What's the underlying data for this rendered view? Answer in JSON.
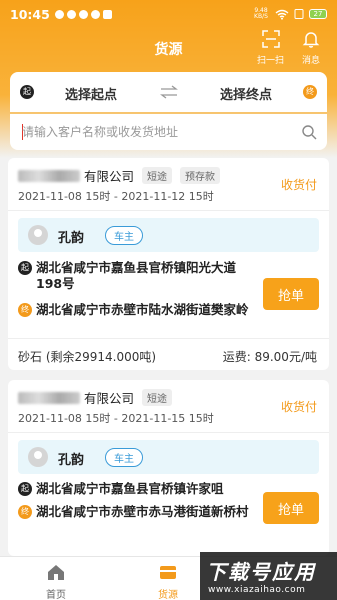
{
  "status_bar": {
    "time": "10:45",
    "network": "9.48 KB/S",
    "battery": "27"
  },
  "header": {
    "title": "货源",
    "scan_label": "扫一扫",
    "message_label": "消息"
  },
  "route": {
    "start_badge": "起",
    "start_label": "选择起点",
    "end_label": "选择终点",
    "end_badge": "终"
  },
  "search": {
    "placeholder": "请输入客户名称或收发货地址"
  },
  "cards": [
    {
      "company_suffix": "有限公司",
      "tags": [
        "短途",
        "预存款"
      ],
      "date_range": "2021-11-08 15时 - 2021-11-12 15时",
      "payment": "收货付",
      "owner_name": "孔韵",
      "owner_role": "车主",
      "start_badge": "起",
      "from": "湖北省咸宁市嘉鱼县官桥镇阳光大道198号",
      "end_badge": "终",
      "to": "湖北省咸宁市赤壁市陆水湖街道樊家岭",
      "action": "抢单",
      "cargo": "砂石 (剩余29914.000吨)",
      "fee": "运费: 89.00元/吨"
    },
    {
      "company_suffix": "有限公司",
      "tags": [
        "短途"
      ],
      "date_range": "2021-11-08 15时 - 2021-11-15 15时",
      "payment": "收货付",
      "owner_name": "孔韵",
      "owner_role": "车主",
      "start_badge": "起",
      "from": "湖北省咸宁市嘉鱼县官桥镇许家咀",
      "end_badge": "终",
      "to": "湖北省咸宁市赤壁市赤马港街道新桥村",
      "action": "抢单"
    }
  ],
  "tabbar": {
    "home": "首页",
    "cargo": "货源"
  },
  "watermark": {
    "title": "下载号应用",
    "url": "www.xiazaihao.com"
  },
  "colors": {
    "accent": "#f7a21a",
    "start_badge": "#222222",
    "end_badge": "#f39a1b",
    "role": "#3a9bd8"
  }
}
